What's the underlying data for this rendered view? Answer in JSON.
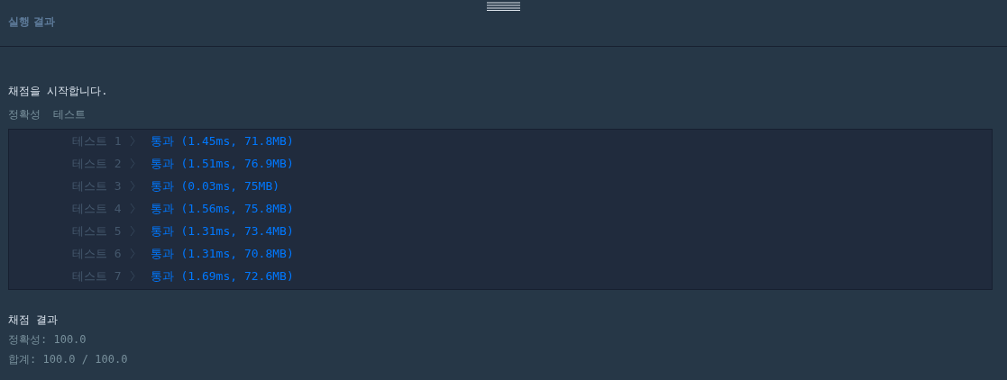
{
  "panel": {
    "title": "실행 결과"
  },
  "output": {
    "start_message": "채점을 시작합니다.",
    "section_label": "정확성  테스트",
    "tests": [
      {
        "label": "테스트 1",
        "passed": true,
        "result": "통과 (1.45ms, 71.8MB)"
      },
      {
        "label": "테스트 2",
        "passed": true,
        "result": "통과 (1.51ms, 76.9MB)"
      },
      {
        "label": "테스트 3",
        "passed": true,
        "result": "통과 (0.03ms, 75MB)"
      },
      {
        "label": "테스트 4",
        "passed": true,
        "result": "통과 (1.56ms, 75.8MB)"
      },
      {
        "label": "테스트 5",
        "passed": true,
        "result": "통과 (1.31ms, 73.4MB)"
      },
      {
        "label": "테스트 6",
        "passed": true,
        "result": "통과 (1.31ms, 70.8MB)"
      },
      {
        "label": "테스트 7",
        "passed": true,
        "result": "통과 (1.69ms, 72.6MB)"
      }
    ],
    "summary_title": "채점 결과",
    "summary_lines": [
      "정확성: 100.0",
      "합계: 100.0 / 100.0"
    ]
  }
}
